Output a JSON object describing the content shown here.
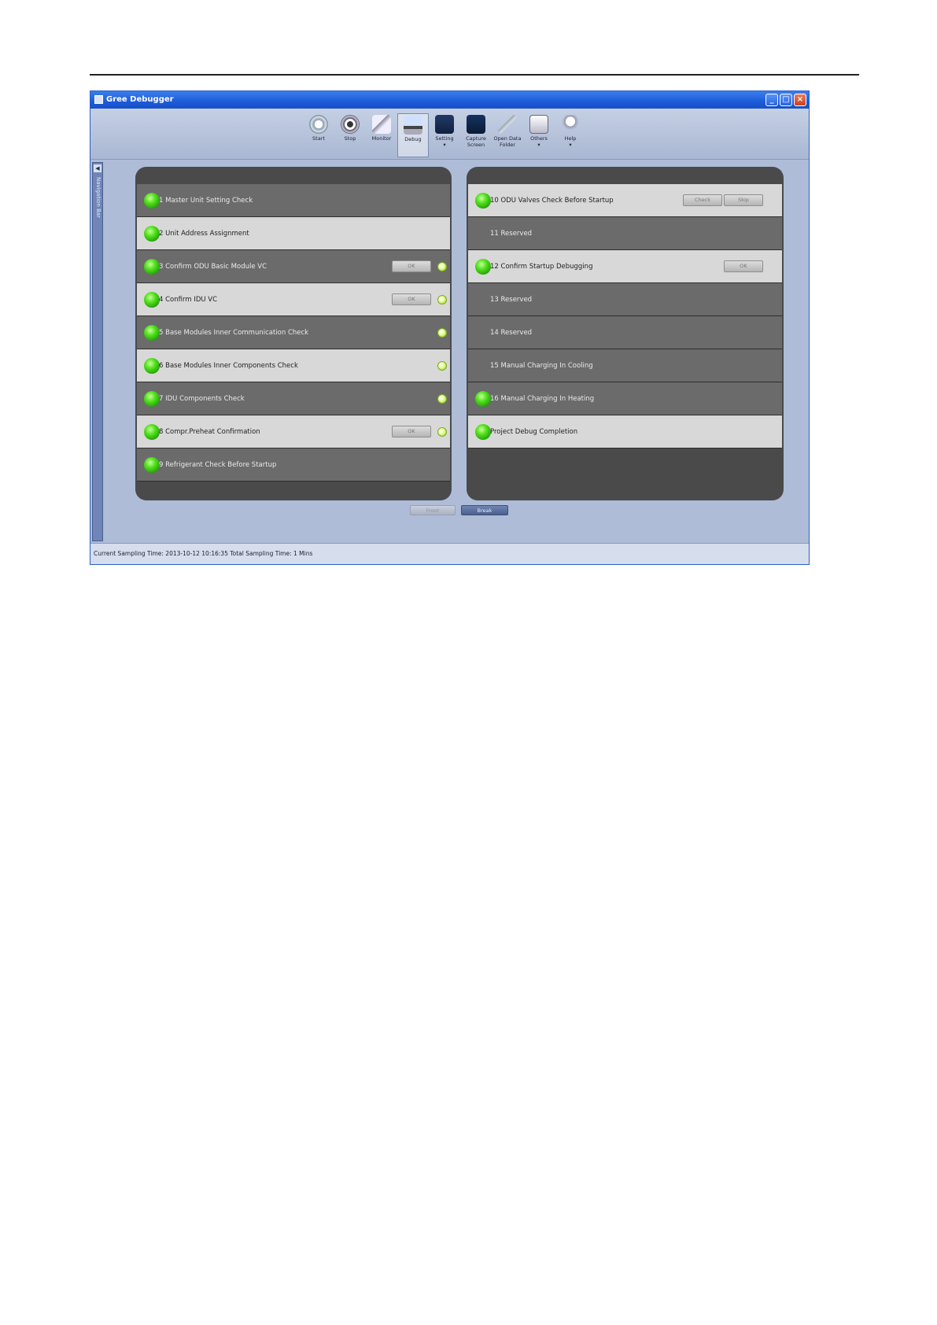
{
  "window": {
    "title": "Gree Debugger"
  },
  "toolbar": {
    "items": [
      {
        "label": "Start",
        "icon": "start-icon"
      },
      {
        "label": "Stop",
        "icon": "stop-icon"
      },
      {
        "label": "Monitor",
        "icon": "monitor-icon"
      },
      {
        "label": "Debug",
        "icon": "debug-icon",
        "active": true
      },
      {
        "label": "Setting\n▾",
        "icon": "setting-icon"
      },
      {
        "label": "Capture\nScreen",
        "icon": "capture-screen-icon"
      },
      {
        "label": "Open Data\nFolder",
        "icon": "folder-icon"
      },
      {
        "label": "Others\n▾",
        "icon": "others-icon"
      },
      {
        "label": "Help\n▾",
        "icon": "help-icon"
      }
    ]
  },
  "navigation": {
    "label": "Navigation Bar"
  },
  "left_steps": [
    {
      "label": "1 Master Unit Setting Check",
      "shade": "dark",
      "ball": true
    },
    {
      "label": "2 Unit Address Assignment",
      "shade": "light",
      "ball": true
    },
    {
      "label": "3 Confirm ODU Basic Module VC",
      "shade": "dark",
      "ball": true,
      "button": "OK",
      "dot": true
    },
    {
      "label": "4 Confirm IDU VC",
      "shade": "light",
      "ball": true,
      "button": "OK",
      "dot": true
    },
    {
      "label": "5 Base Modules Inner Communication Check",
      "shade": "dark",
      "ball": true,
      "dot": true
    },
    {
      "label": "6 Base Modules Inner Components Check",
      "shade": "light",
      "ball": true,
      "dot": true
    },
    {
      "label": "7 IDU Components Check",
      "shade": "dark",
      "ball": true,
      "dot": true
    },
    {
      "label": "8 Compr.Preheat Confirmation",
      "shade": "light",
      "ball": true,
      "button": "OK",
      "dot": true
    },
    {
      "label": "9 Refrigerant Check Before Startup",
      "shade": "dark",
      "ball": true
    }
  ],
  "right_steps": [
    {
      "label": "10 ODU Valves Check Before Startup",
      "shade": "light",
      "ball": true,
      "buttons": [
        "Check",
        "Skip"
      ]
    },
    {
      "label": "11  Reserved",
      "shade": "dark",
      "ball": false
    },
    {
      "label": "12 Confirm Startup Debugging",
      "shade": "light",
      "ball": true,
      "button": "OK"
    },
    {
      "label": "13 Reserved",
      "shade": "dark",
      "ball": false
    },
    {
      "label": "14 Reserved",
      "shade": "dark",
      "ball": false
    },
    {
      "label": "15 Manual Charging In Cooling",
      "shade": "dark",
      "ball": false
    },
    {
      "label": "16 Manual Charging In Heating",
      "shade": "dark",
      "ball": true
    },
    {
      "label": "Project Debug Completion",
      "shade": "light",
      "ball": true
    }
  ],
  "nav_buttons": {
    "prev": "Front",
    "next": "Break"
  },
  "status": {
    "text": "Current Sampling Time: 2013-10-12 10:16:35  Total Sampling Time: 1 Mins"
  }
}
